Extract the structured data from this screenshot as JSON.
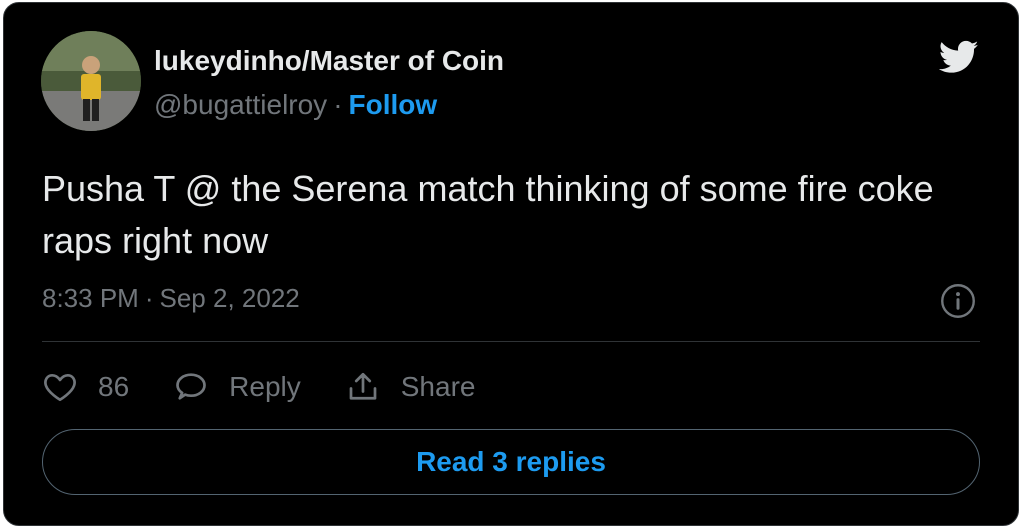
{
  "author": {
    "display_name": "lukeydinho/Master of Coin",
    "handle": "@bugattielroy",
    "separator": "·",
    "follow_label": "Follow"
  },
  "tweet": {
    "text": "Pusha T @ the Serena match thinking of some fire coke raps right now",
    "time": "8:33 PM",
    "date": "Sep 2, 2022",
    "separator": "·"
  },
  "actions": {
    "like_count": "86",
    "reply_label": "Reply",
    "share_label": "Share"
  },
  "footer": {
    "read_replies_label": "Read 3 replies"
  },
  "colors": {
    "background": "#000000",
    "text": "#e7e9ea",
    "muted": "#71767b",
    "accent": "#1d9bf0",
    "border": "#2f3336"
  },
  "icons": {
    "brand": "twitter-bird-icon",
    "info": "info-icon",
    "like": "heart-icon",
    "reply": "speech-bubble-icon",
    "share": "share-upload-icon"
  }
}
